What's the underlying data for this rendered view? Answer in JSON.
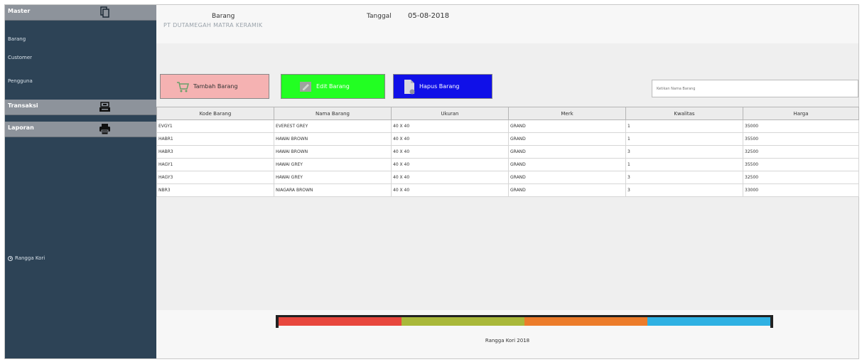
{
  "sidebar": {
    "master": {
      "title": "Master",
      "icon": "copy-icon"
    },
    "items": [
      {
        "label": "Barang"
      },
      {
        "label": "Customer"
      },
      {
        "label": "Pengguna"
      }
    ],
    "transaksi": {
      "title": "Transaksi",
      "icon": "cash-register-icon"
    },
    "laporan": {
      "title": "Laporan",
      "icon": "printer-icon"
    },
    "user": "Rangga Kori"
  },
  "header": {
    "title": "Barang",
    "company": "PT DUTAMEGAH MATRA KERAMIK",
    "date_label": "Tanggal",
    "date_value": "05-08-2018"
  },
  "toolbar": {
    "add_label": "Tambah Barang",
    "edit_label": "Edit Barang",
    "delete_label": "Hapus Barang",
    "search_placeholder": "Ketikan Nama Barang"
  },
  "table": {
    "columns": [
      "Kode Barang",
      "Nama Barang",
      "Ukuran",
      "Merk",
      "Kwalitas",
      "Harga"
    ],
    "rows": [
      [
        "EVGY1",
        "EVEREST GREY",
        "40 X 40",
        "GRAND",
        "1",
        "35000"
      ],
      [
        "HABR1",
        "HAWAI BROWN",
        "40 X 40",
        "GRAND",
        "1",
        "35500"
      ],
      [
        "HABR3",
        "HAWAI BROWN",
        "40 X 40",
        "GRAND",
        "3",
        "32500"
      ],
      [
        "HAGY1",
        "HAWAI GREY",
        "40 X 40",
        "GRAND",
        "1",
        "35500"
      ],
      [
        "HAGY3",
        "HAWAI GREY",
        "40 X 40",
        "GRAND",
        "3",
        "32500"
      ],
      [
        "NBR3",
        "NIAGARA BROWN",
        "40 X 40",
        "GRAND",
        "3",
        "33000"
      ]
    ]
  },
  "footer": {
    "text": "Rangga Kori 2018",
    "bar_colors": [
      "#e8473e",
      "#a9b83a",
      "#ec7c2b",
      "#2fb1e3"
    ]
  },
  "colors": {
    "sidebar_bg": "#2d4356",
    "header_bg": "#8d939b",
    "add_button": "#f5b2b2",
    "edit_button": "#22ff22",
    "delete_button": "#1010e8"
  }
}
